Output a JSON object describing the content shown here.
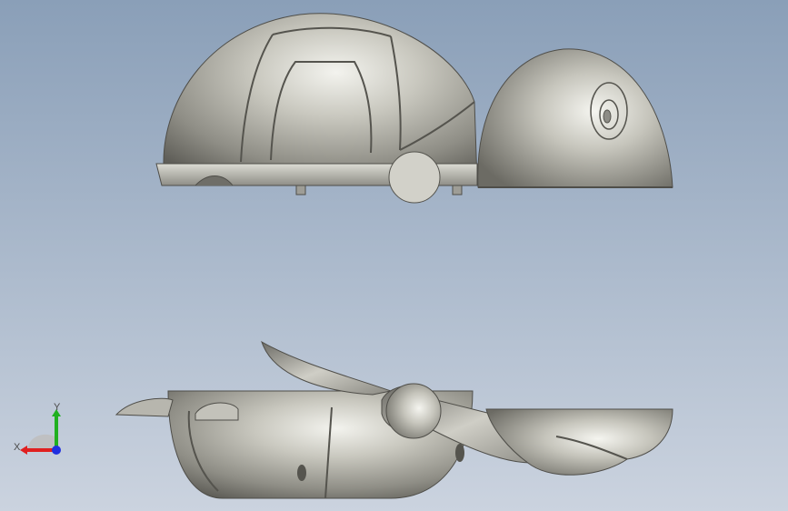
{
  "viewport": {
    "background_top": "#8a9fb8",
    "background_bottom": "#c9d1de"
  },
  "model": {
    "parts": [
      "shell-top",
      "head",
      "lower-shell",
      "front-flipper",
      "rear-flipper",
      "tail"
    ],
    "material_color": "#b8b7ae"
  },
  "triad": {
    "x_label": "X",
    "y_label": "Y",
    "x_color": "#e02020",
    "y_color": "#20b020",
    "z_color": "#2030e0"
  }
}
